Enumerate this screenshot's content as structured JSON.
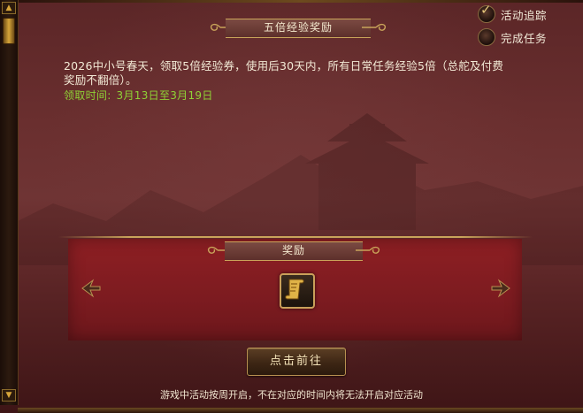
{
  "header": {
    "title": "五倍经验奖励"
  },
  "options": [
    {
      "label": "活动追踪",
      "checked": true
    },
    {
      "label": "完成任务",
      "checked": false
    }
  ],
  "description": {
    "text": "2026中小号春天，领取5倍经验券，使用后30天内，所有日常任务经验5倍（总舵及付费奖励不翻倍）。",
    "period_label": "领取时间:",
    "period_value": "3月13日至3月19日"
  },
  "reward": {
    "title": "奖励",
    "items": [
      {
        "icon": "scroll-icon"
      }
    ]
  },
  "action": {
    "label": "点击前往"
  },
  "footer": {
    "note": "游戏中活动按周开启，不在对应的时间内将无法开启对应活动"
  },
  "colors": {
    "accent_gold": "#c9a45a",
    "period_green": "#8fd236",
    "reward_red": "#8e1f23"
  }
}
